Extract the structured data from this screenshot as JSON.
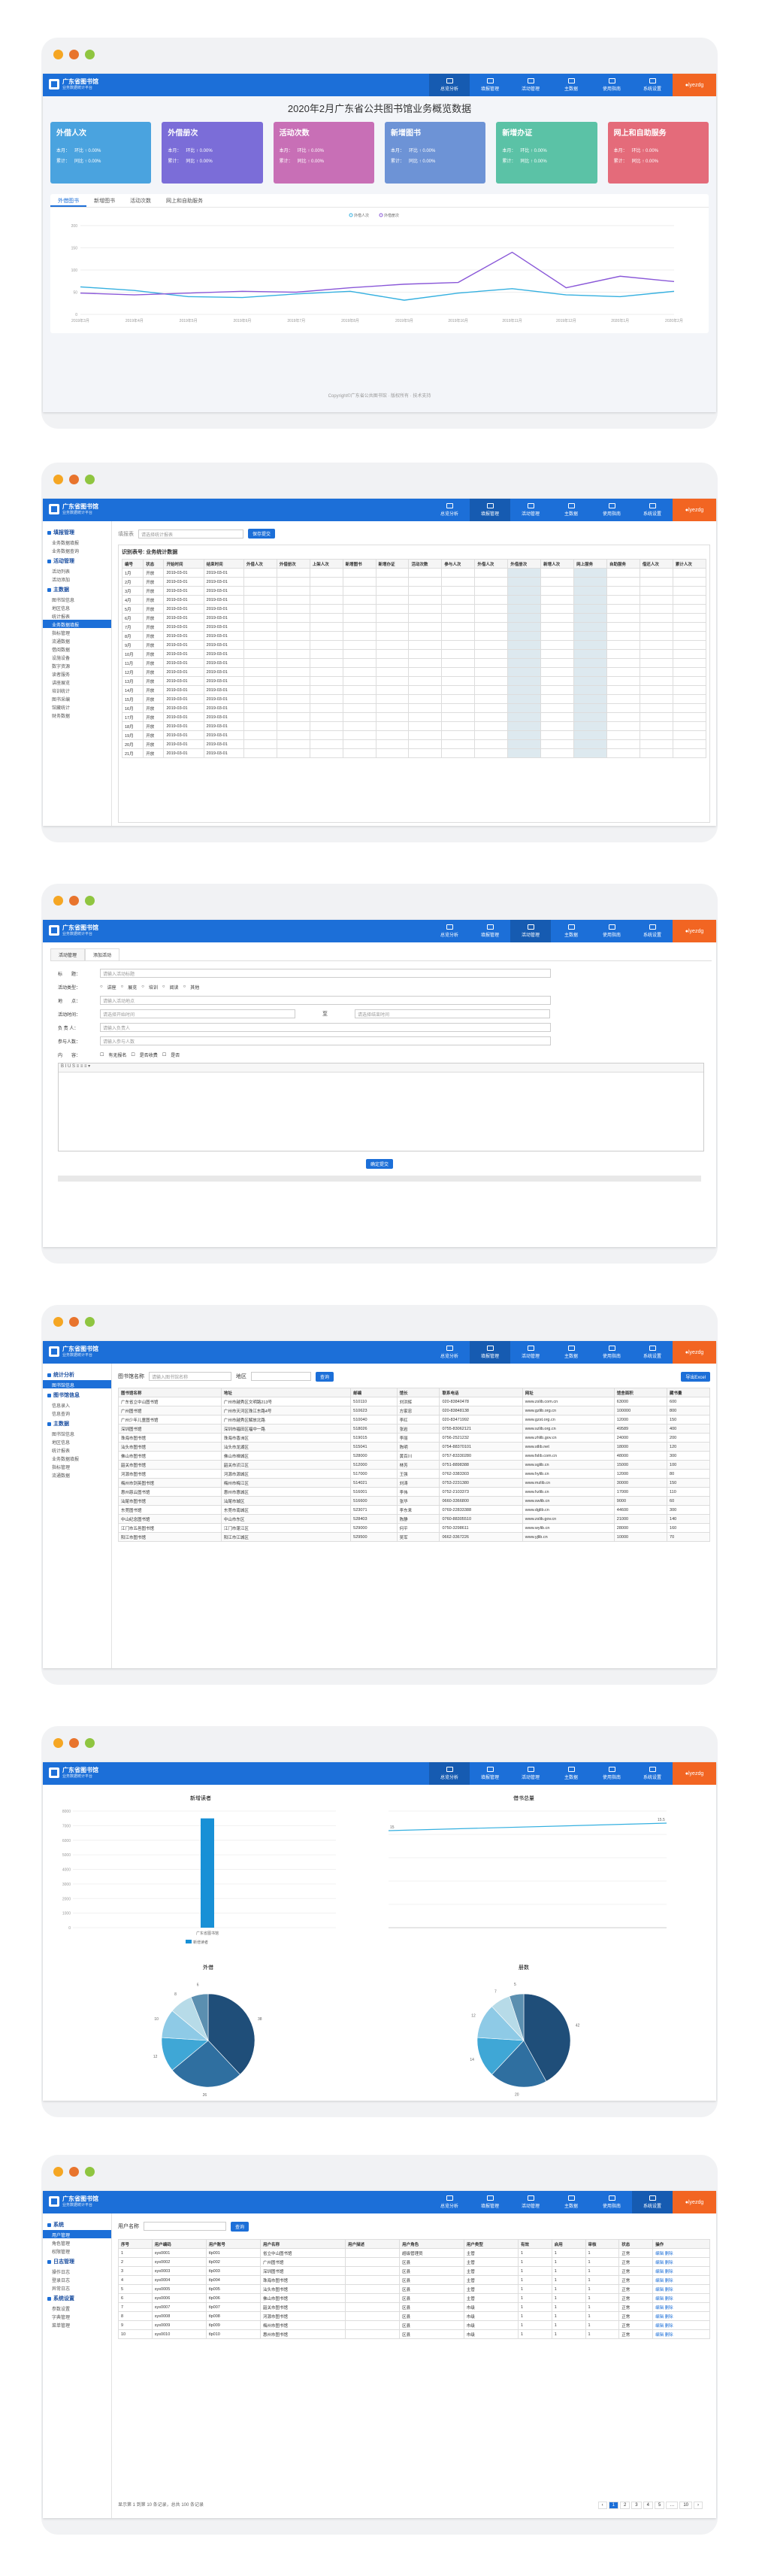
{
  "app": {
    "name": "广东省图书馆",
    "subtitle": "业务数据统计平台",
    "user": "lyezdg"
  },
  "nav": [
    {
      "label": "总览分析"
    },
    {
      "label": "填报管理"
    },
    {
      "label": "活动管理"
    },
    {
      "label": "主数据"
    },
    {
      "label": "使用指南"
    },
    {
      "label": "系统设置"
    }
  ],
  "dashboard": {
    "title": "2020年2月广东省公共图书馆业务概览数据",
    "kpis": [
      {
        "title": "外借人次",
        "color": "#4aa3df",
        "rows": [
          "本月：",
          "累计："
        ],
        "mom": "环比 ↑ 0.00%",
        "yoy": "同比 ↑ 0.00%"
      },
      {
        "title": "外借册次",
        "color": "#7b6dd8",
        "rows": [
          "本月：",
          "累计："
        ],
        "mom": "环比 ↑ 0.00%",
        "yoy": "同比 ↑ 0.00%"
      },
      {
        "title": "活动次数",
        "color": "#c86fb6",
        "rows": [
          "本月：",
          "累计："
        ],
        "mom": "环比 ↑ 0.00%",
        "yoy": "同比 ↑ 0.00%"
      },
      {
        "title": "新增图书",
        "color": "#6d93d6",
        "rows": [
          "本月：",
          "累计："
        ],
        "mom": "环比 ↑ 0.00%",
        "yoy": "同比 ↑ 0.00%"
      },
      {
        "title": "新增办证",
        "color": "#5bc2a6",
        "rows": [
          "本月：",
          "累计："
        ],
        "mom": "环比 ↑ 0.00%",
        "yoy": "同比 ↑ 0.00%"
      },
      {
        "title": "网上和自助服务",
        "color": "#e46b7a",
        "rows": [
          "本月：",
          "累计："
        ],
        "mom": "环比 ↑ 0.00%",
        "yoy": "同比 ↑ 0.00%"
      }
    ],
    "tabs": [
      "外借图书",
      "新增图书",
      "活动次数",
      "网上和自助服务"
    ],
    "legend": [
      "外借人次",
      "外借册次"
    ],
    "footer": "Copyright©广东省公共图书馆 · 版权所有 · 技术支持"
  },
  "chart_data": [
    {
      "type": "line",
      "title": "",
      "x": [
        "2019年3月",
        "2019年4月",
        "2019年5月",
        "2019年6月",
        "2019年7月",
        "2019年8月",
        "2019年9月",
        "2019年10月",
        "2019年11月",
        "2019年12月",
        "2020年1月",
        "2020年2月"
      ],
      "series": [
        {
          "name": "外借人次",
          "color": "#35b0e0",
          "values": [
            62,
            54,
            40,
            38,
            46,
            52,
            32,
            48,
            58,
            44,
            40,
            52
          ]
        },
        {
          "name": "外借册次",
          "color": "#8a58d8",
          "values": [
            48,
            44,
            48,
            52,
            50,
            60,
            68,
            72,
            140,
            60,
            86,
            74
          ]
        }
      ],
      "ylim": [
        0,
        200
      ]
    },
    {
      "type": "bar",
      "title": "新增读者",
      "categories": [
        "广东省图书馆"
      ],
      "series": [
        {
          "name": "新增读者",
          "color": "#1890d6",
          "values": [
            7500
          ]
        }
      ],
      "ylim": [
        0,
        8000
      ]
    },
    {
      "type": "line",
      "title": "借书总量",
      "x": [
        "1",
        "2"
      ],
      "series": [
        {
          "name": "借书总量",
          "values": [
            15.0,
            15.5
          ]
        }
      ]
    },
    {
      "type": "pie",
      "title": "外借",
      "values": [
        38,
        26,
        12,
        10,
        8,
        6
      ]
    },
    {
      "type": "pie",
      "title": "册数",
      "values": [
        42,
        20,
        14,
        12,
        7,
        5
      ]
    }
  ],
  "fill": {
    "tab1": "填报表",
    "title": "识别表号: 业务统计数据",
    "select": "请选择统计报表",
    "submit": "保存提交",
    "cols": [
      "编号",
      "状态",
      "开始时间",
      "结束时间",
      "外借人次",
      "外借册次",
      "上架人次",
      "新增图书",
      "新增办证",
      "活动次数",
      "参与人次",
      "外借人次",
      "外借册次",
      "新增人次",
      "网上服务",
      "自助服务",
      "借还人次",
      "累计人次"
    ],
    "rows": [
      "1月",
      "2月",
      "3月",
      "4月",
      "5月",
      "6月",
      "7月",
      "8月",
      "9月",
      "10月",
      "11月",
      "12月",
      "13月",
      "14月",
      "15月",
      "16月",
      "17月",
      "18月",
      "19月",
      "20月",
      "21月"
    ],
    "status": "开放",
    "date": "2019-03-01"
  },
  "activity": {
    "tabs": [
      "活动管理",
      "添加活动"
    ],
    "labels": [
      "标　　题：",
      "活动类型：",
      "地　　点：",
      "活动时间：",
      "负 责 人：",
      "参与人数：",
      "内　　容："
    ],
    "types": [
      "讲座",
      "展览",
      "培训",
      "阅读",
      "其他"
    ],
    "ph_title": "请输入活动标题",
    "ph_place": "请输入活动地点",
    "ph_start": "请选择开始时间",
    "ph_end": "请选择结束时间",
    "ph_owner": "请输入负责人",
    "ph_count": "请输入参与人数",
    "audience": [
      "有无报名",
      "是否收费",
      "是否"
    ],
    "submit": "确定提交",
    "to": "至"
  },
  "libs": {
    "search_label": "图书馆名称",
    "ph": "请输入图书馆名称",
    "level_label": "地区",
    "search": "查询",
    "export": "导出Excel",
    "cols": [
      "图书馆名称",
      "地址",
      "邮编",
      "馆长",
      "联系电话",
      "网址",
      "馆舍面积",
      "藏书量"
    ],
    "rows": [
      [
        "广东省立中山图书馆",
        "广州市越秀区文明路213号",
        "510110",
        "刘洪辉",
        "020-83840478",
        "www.zslib.com.cn",
        "63000",
        "600"
      ],
      [
        "广州图书馆",
        "广州市天河区珠江东路4号",
        "510623",
        "方家忠",
        "020-83848138",
        "www.gzlib.org.cn",
        "100000",
        "800"
      ],
      [
        "广州少年儿童图书馆",
        "广州市越秀区解放北路",
        "510040",
        "李红",
        "020-83471992",
        "www.gzst.org.cn",
        "12000",
        "150"
      ],
      [
        "深圳图书馆",
        "深圳市福田区福中一路",
        "518026",
        "张岩",
        "0755-83062121",
        "www.szlib.org.cn",
        "49589",
        "400"
      ],
      [
        "珠海市图书馆",
        "珠海市香洲区",
        "519015",
        "李丽",
        "0756-2521232",
        "www.zhlib.gov.cn",
        "24000",
        "200"
      ],
      [
        "汕头市图书馆",
        "汕头市龙湖区",
        "515041",
        "陈明",
        "0754-88370101",
        "www.stlib.net",
        "18000",
        "120"
      ],
      [
        "佛山市图书馆",
        "佛山市禅城区",
        "528000",
        "黄百川",
        "0757-83330280",
        "www.fslib.com.cn",
        "48000",
        "300"
      ],
      [
        "韶关市图书馆",
        "韶关市浈江区",
        "512000",
        "林芳",
        "0751-8898388",
        "www.sglib.cn",
        "15000",
        "100"
      ],
      [
        "河源市图书馆",
        "河源市源城区",
        "517000",
        "王强",
        "0762-3383303",
        "www.hylib.cn",
        "12000",
        "80"
      ],
      [
        "梅州市剑英图书馆",
        "梅州市梅江区",
        "514021",
        "刘涛",
        "0753-2231380",
        "www.mzlib.cn",
        "30000",
        "150"
      ],
      [
        "惠州慈云图书馆",
        "惠州市惠城区",
        "516001",
        "李伟",
        "0752-2103373",
        "www.hzlib.cn",
        "17000",
        "110"
      ],
      [
        "汕尾市图书馆",
        "汕尾市城区",
        "516600",
        "张华",
        "0660-3366800",
        "www.swlib.cn",
        "9000",
        "60"
      ],
      [
        "东莞图书馆",
        "东莞市南城区",
        "523071",
        "李东来",
        "0769-22833388",
        "www.dglib.cn",
        "44600",
        "300"
      ],
      [
        "中山纪念图书馆",
        "中山市东区",
        "528403",
        "陈静",
        "0760-88305510",
        "www.zslib.gov.cn",
        "21000",
        "140"
      ],
      [
        "江门市五邑图书馆",
        "江门市蓬江区",
        "529000",
        "何平",
        "0750-3298611",
        "www.wylib.cn",
        "28000",
        "160"
      ],
      [
        "阳江市图书馆",
        "阳江市江城区",
        "529500",
        "吴军",
        "0662-3367226",
        "www.yjlib.cn",
        "10000",
        "70"
      ]
    ]
  },
  "sys": {
    "search_label": "用户名称",
    "search": "查询",
    "cols": [
      "序号",
      "用户编码",
      "用户账号",
      "用户名称",
      "用户描述",
      "用户角色",
      "用户类型",
      "有效",
      "启用",
      "审核",
      "状态",
      "操作"
    ],
    "rows": [
      [
        "1",
        "sys0001",
        "tlp001",
        "省立中山图书馆",
        "",
        "超级管理员",
        "主管",
        "1",
        "1",
        "1",
        "正常",
        "编辑 删除"
      ],
      [
        "2",
        "sys0002",
        "tlp002",
        "广州图书馆",
        "",
        "区县",
        "主管",
        "1",
        "1",
        "1",
        "正常",
        "编辑 删除"
      ],
      [
        "3",
        "sys0003",
        "tlp003",
        "深圳图书馆",
        "",
        "区县",
        "主管",
        "1",
        "1",
        "1",
        "正常",
        "编辑 删除"
      ],
      [
        "4",
        "sys0004",
        "tlp004",
        "珠海市图书馆",
        "",
        "区县",
        "主管",
        "1",
        "1",
        "1",
        "正常",
        "编辑 删除"
      ],
      [
        "5",
        "sys0005",
        "tlp005",
        "汕头市图书馆",
        "",
        "区县",
        "主管",
        "1",
        "1",
        "1",
        "正常",
        "编辑 删除"
      ],
      [
        "6",
        "sys0006",
        "tlp006",
        "佛山市图书馆",
        "",
        "区县",
        "主管",
        "1",
        "1",
        "1",
        "正常",
        "编辑 删除"
      ],
      [
        "7",
        "sys0007",
        "tlp007",
        "韶关市图书馆",
        "",
        "区县",
        "市级",
        "1",
        "1",
        "1",
        "正常",
        "编辑 删除"
      ],
      [
        "8",
        "sys0008",
        "tlp008",
        "河源市图书馆",
        "",
        "区县",
        "市级",
        "1",
        "1",
        "1",
        "正常",
        "编辑 删除"
      ],
      [
        "9",
        "sys0009",
        "tlp009",
        "梅州市图书馆",
        "",
        "区县",
        "市级",
        "1",
        "1",
        "1",
        "正常",
        "编辑 删除"
      ],
      [
        "10",
        "sys0010",
        "tlp010",
        "惠州市图书馆",
        "",
        "区县",
        "市级",
        "1",
        "1",
        "1",
        "正常",
        "编辑 删除"
      ]
    ],
    "footer": "显示第 1 到第 10 条记录，总共 100 条记录",
    "pages": [
      "‹",
      "1",
      "2",
      "3",
      "4",
      "5",
      "…",
      "10",
      "›"
    ]
  },
  "sidebar": {
    "fill": [
      {
        "group": "填报管理",
        "items": [
          "业务数据填报",
          "业务数据查询"
        ]
      },
      {
        "group": "活动管理",
        "items": [
          "活动列表",
          "活动添加"
        ]
      },
      {
        "group": "主数据",
        "items": [
          "图书馆信息",
          "地区信息",
          "统计报表",
          "业务数据填报",
          "指标管理",
          "流通数据",
          "借阅数据",
          "设施设备",
          "数字资源",
          "读者服务",
          "讲座展览",
          "培训统计",
          "图书采编",
          "馆藏统计",
          "财务数据"
        ]
      }
    ],
    "libs": [
      {
        "group": "统计分析",
        "items": [
          "图书馆信息"
        ]
      },
      {
        "group": "图书馆信息",
        "items": [
          "信息录入",
          "信息查询"
        ]
      },
      {
        "group": "主数据",
        "items": [
          "图书馆信息",
          "地区信息",
          "统计报表",
          "业务数据填报",
          "指标管理",
          "流通数据"
        ]
      }
    ],
    "sys": [
      {
        "group": "系统",
        "items": [
          "用户管理",
          "角色管理",
          "权限管理"
        ]
      },
      {
        "group": "日志管理",
        "items": [
          "操作日志",
          "登录日志",
          "异常日志"
        ]
      },
      {
        "group": "系统设置",
        "items": [
          "参数设置",
          "字典管理",
          "菜单管理"
        ]
      }
    ]
  }
}
